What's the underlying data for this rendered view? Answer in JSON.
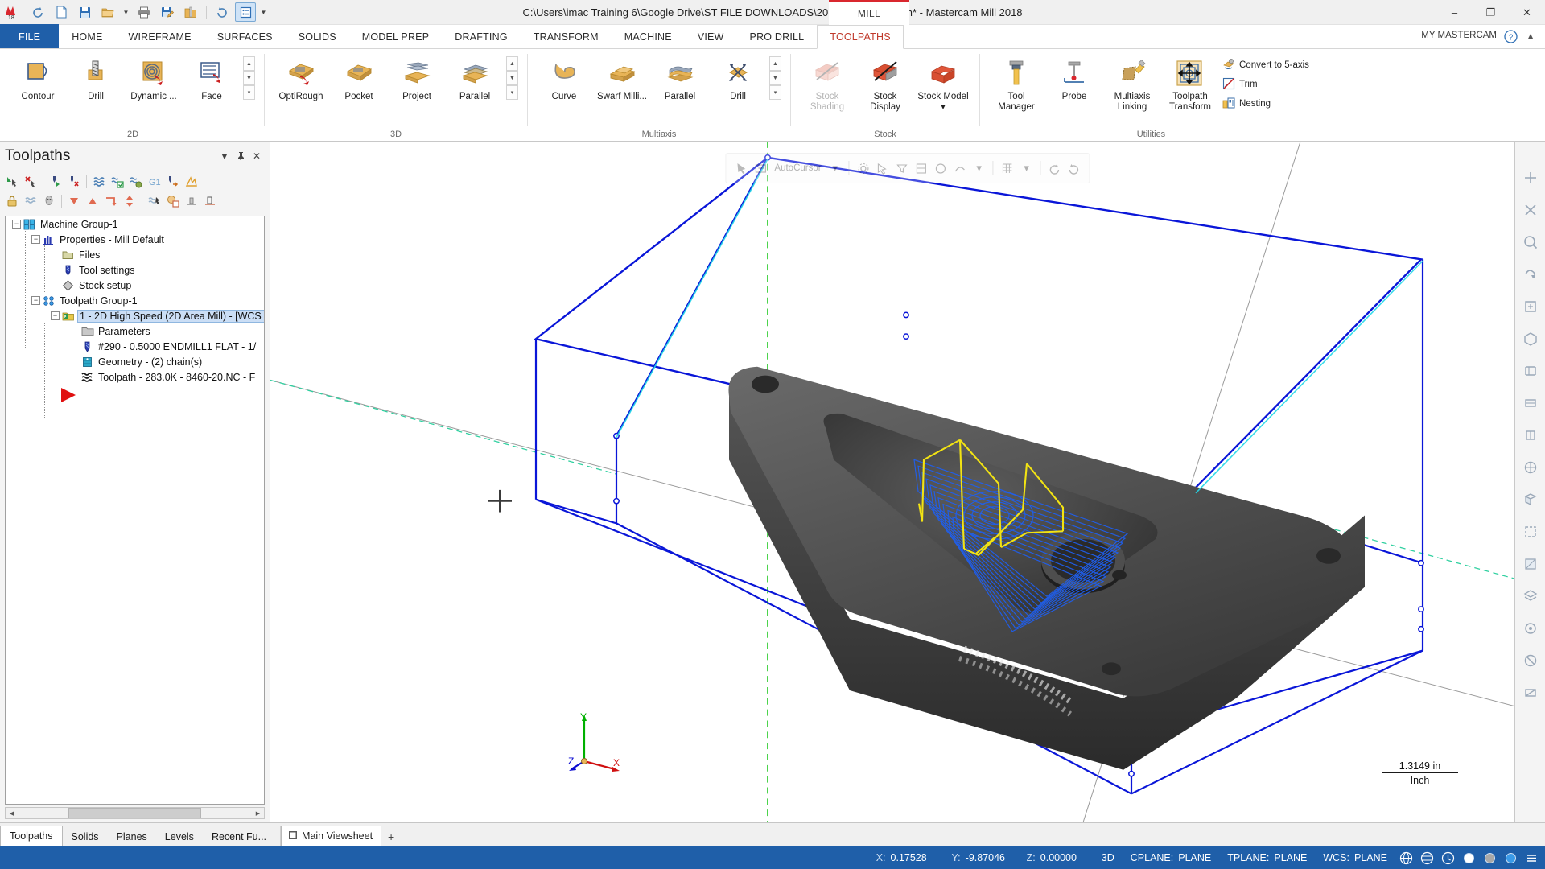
{
  "titlebar": {
    "document_path": "C:\\Users\\imac Training 6\\Google Drive\\ST FILE DOWNLOADS\\2018\\8460-20.mcam* - Mastercam Mill 2018",
    "machine_tab": "MILL",
    "quick_access": [
      {
        "name": "redo-arrow-icon",
        "glyph": "↷"
      },
      {
        "name": "new-file-icon",
        "glyph": "new"
      },
      {
        "name": "save-icon",
        "glyph": "save"
      },
      {
        "name": "open-folder-icon",
        "glyph": "open"
      },
      {
        "name": "open-dropdown-caret",
        "glyph": "▾"
      },
      {
        "name": "print-icon",
        "glyph": "print"
      },
      {
        "name": "save-as-icon",
        "glyph": "saveas"
      },
      {
        "name": "zip2go-icon",
        "glyph": "zip"
      },
      {
        "name": "undo-icon",
        "glyph": "↶"
      },
      {
        "name": "toolpath-manager-icon",
        "glyph": "tpm"
      },
      {
        "name": "customize-qat-caret",
        "glyph": "▾"
      }
    ],
    "window_controls": {
      "minimize": "–",
      "maximize": "❐",
      "close": "✕"
    }
  },
  "ribbon_tabs": {
    "file": "FILE",
    "items": [
      "HOME",
      "WIREFRAME",
      "SURFACES",
      "SOLIDS",
      "MODEL PREP",
      "DRAFTING",
      "TRANSFORM",
      "MACHINE",
      "VIEW",
      "PRO DRILL",
      "TOOLPATHS"
    ],
    "selected": "TOOLPATHS",
    "my_mastercam": "MY MASTERCAM",
    "help_icon": "help-icon",
    "collapse_icon": "chevron-up-icon"
  },
  "ribbon": {
    "groups": [
      {
        "label": "2D",
        "buttons": [
          {
            "label": "Contour",
            "icon": "contour-icon",
            "disabled": false
          },
          {
            "label": "Drill",
            "icon": "drill-icon",
            "disabled": false
          },
          {
            "label": "Dynamic ...",
            "icon": "dynamic-mill-icon",
            "disabled": false
          },
          {
            "label": "Face",
            "icon": "face-icon",
            "disabled": false
          }
        ],
        "has_scroller": true
      },
      {
        "label": "3D",
        "buttons": [
          {
            "label": "OptiRough",
            "icon": "optirough-icon",
            "disabled": false
          },
          {
            "label": "Pocket",
            "icon": "pocket-3d-icon",
            "disabled": false
          },
          {
            "label": "Project",
            "icon": "project-icon",
            "disabled": false
          },
          {
            "label": "Parallel",
            "icon": "parallel-3d-icon",
            "disabled": false
          }
        ],
        "has_scroller": true
      },
      {
        "label": "Multiaxis",
        "buttons": [
          {
            "label": "Curve",
            "icon": "curve-icon",
            "disabled": false
          },
          {
            "label": "Swarf Milli...",
            "icon": "swarf-milling-icon",
            "disabled": false
          },
          {
            "label": "Parallel",
            "icon": "parallel-multiaxis-icon",
            "disabled": false
          },
          {
            "label": "Drill",
            "icon": "drill-multiaxis-icon",
            "disabled": false
          }
        ],
        "has_scroller": true
      },
      {
        "label": "Stock",
        "buttons": [
          {
            "label": "Stock Shading",
            "icon": "stock-shading-icon",
            "disabled": true
          },
          {
            "label": "Stock Display",
            "icon": "stock-display-icon",
            "disabled": false
          },
          {
            "label": "Stock Model ▾",
            "icon": "stock-model-icon",
            "disabled": false
          }
        ],
        "has_scroller": false
      },
      {
        "label": "Utilities",
        "buttons": [
          {
            "label": "Tool Manager",
            "icon": "tool-manager-icon",
            "disabled": false
          },
          {
            "label": "Probe",
            "icon": "probe-icon",
            "disabled": false
          },
          {
            "label": "Multiaxis Linking",
            "icon": "multiaxis-linking-icon",
            "disabled": false
          },
          {
            "label": "Toolpath Transform",
            "icon": "toolpath-transform-icon",
            "disabled": false
          }
        ],
        "small_buttons": [
          {
            "label": "Convert to 5-axis",
            "icon": "convert-5axis-icon"
          },
          {
            "label": "Trim",
            "icon": "trim-icon"
          },
          {
            "label": "Nesting",
            "icon": "nesting-icon"
          }
        ],
        "has_scroller": false
      }
    ]
  },
  "toolpaths_panel": {
    "title": "Toolpaths",
    "header_buttons": [
      {
        "name": "panel-dropdown-icon",
        "glyph": "▾"
      },
      {
        "name": "panel-pin-icon",
        "glyph": "pin"
      },
      {
        "name": "panel-close-icon",
        "glyph": "✕"
      }
    ],
    "toolbar_row1": [
      "select-all-icon",
      "deselect-all-icon",
      "select-invalid-icon",
      "delete-selected-icon",
      "regen-dirty-icon",
      "regen-selected-icon",
      "regen-all-icon",
      "g1-post-icon",
      "post-selected-icon",
      "high-feed-icon"
    ],
    "toolbar_row2": [
      "lock-icon",
      "toggle-display-icon",
      "toggle-posting-icon",
      "move-down-icon",
      "move-up-icon",
      "move-into-icon",
      "move-updown-icon",
      "verify-icon",
      "simulate-icon",
      "backplot-icon",
      "config-icon"
    ],
    "tree": [
      {
        "depth": 0,
        "label": "Machine Group-1",
        "icon": "machine-group-icon",
        "expander": "-",
        "selected": false
      },
      {
        "depth": 1,
        "label": "Properties - Mill Default",
        "icon": "properties-icon",
        "expander": "-",
        "selected": false
      },
      {
        "depth": 2,
        "label": "Files",
        "icon": "files-folder-icon",
        "expander": "",
        "selected": false
      },
      {
        "depth": 2,
        "label": "Tool settings",
        "icon": "tool-settings-icon",
        "expander": "",
        "selected": false
      },
      {
        "depth": 2,
        "label": "Stock setup",
        "icon": "stock-setup-icon",
        "expander": "",
        "selected": false
      },
      {
        "depth": 1,
        "label": "Toolpath Group-1",
        "icon": "toolpath-group-icon",
        "expander": "-",
        "selected": false
      },
      {
        "depth": 2,
        "label": "1 - 2D High Speed (2D Area Mill) - [WCS",
        "icon": "toolpath-folder-icon",
        "expander": "-",
        "selected": true
      },
      {
        "depth": 3,
        "label": "Parameters",
        "icon": "parameters-icon",
        "expander": "",
        "selected": false
      },
      {
        "depth": 3,
        "label": "#290 - 0.5000 ENDMILL1 FLAT - 1/",
        "icon": "endmill-tool-icon",
        "expander": "",
        "selected": false
      },
      {
        "depth": 3,
        "label": "Geometry -  (2) chain(s)",
        "icon": "geometry-icon",
        "expander": "",
        "selected": false
      },
      {
        "depth": 3,
        "label": "Toolpath - 283.0K - 8460-20.NC - F",
        "icon": "toolpath-nc-icon",
        "expander": "",
        "selected": false
      },
      {
        "depth": 2,
        "label": "",
        "icon": "insert-arrow-icon",
        "expander": "",
        "selected": false
      }
    ],
    "scroll": {
      "left_arrow": "◀",
      "right_arrow": "▶"
    }
  },
  "viewport": {
    "floating_toolbar": [
      {
        "name": "select-entity-icon",
        "glyph": "pointer"
      },
      {
        "name": "autocursor-icon",
        "glyph": "autocursor"
      },
      {
        "name": "autocursor-label",
        "glyph": "AutoCursor"
      },
      {
        "name": "autocursor-dropdown-icon",
        "glyph": "▾"
      },
      {
        "name": "select-settings-icon",
        "glyph": "gear"
      },
      {
        "name": "select-all-entities-icon",
        "glyph": "all"
      },
      {
        "name": "selection-filter-1-icon",
        "glyph": "f1"
      },
      {
        "name": "selection-filter-2-icon",
        "glyph": "f2"
      },
      {
        "name": "selection-filter-3-icon",
        "glyph": "f3"
      },
      {
        "name": "selection-filter-4-icon",
        "glyph": "f4"
      },
      {
        "name": "filter-dropdown-icon",
        "glyph": "▾"
      },
      {
        "name": "grid-snap-icon",
        "glyph": "grid"
      },
      {
        "name": "grid-dropdown-icon",
        "glyph": "▾"
      },
      {
        "name": "undo-view-icon",
        "glyph": "undoview"
      },
      {
        "name": "redo-view-icon",
        "glyph": "redoview"
      }
    ],
    "axis_labels": {
      "x": "X",
      "y": "Y",
      "z": "Z"
    },
    "scale_value": "1.3149 in",
    "scale_unit": "Inch",
    "side_toolbar": [
      "fit-to-screen-icon",
      "unzoom-icon",
      "zoom-window-icon",
      "dynamic-rotate-icon",
      "pan-icon",
      "isometric-view-icon",
      "front-view-icon",
      "top-view-icon",
      "right-view-icon",
      "wireframe-shading-icon",
      "shaded-view-icon",
      "hidden-lines-icon",
      "translucency-icon",
      "levels-icon",
      "blank-icon",
      "clear-colors-icon",
      "hide-entities-icon"
    ]
  },
  "bottom_tabs": {
    "items": [
      "Toolpaths",
      "Solids",
      "Planes",
      "Levels",
      "Recent Fu..."
    ],
    "selected": "Toolpaths",
    "viewsheet": {
      "label": "Main Viewsheet",
      "icon": "viewsheet-icon",
      "add": "+"
    }
  },
  "statusbar": {
    "coords": [
      {
        "key": "X:",
        "value": "0.17528"
      },
      {
        "key": "Y:",
        "value": "-9.87046"
      },
      {
        "key": "Z:",
        "value": "0.00000"
      }
    ],
    "mode": "3D",
    "planes": [
      {
        "key": "CPLANE:",
        "value": "PLANE"
      },
      {
        "key": "TPLANE:",
        "value": "PLANE"
      },
      {
        "key": "WCS:",
        "value": "PLANE"
      }
    ],
    "icons": [
      "globe-icon",
      "globe-alt-icon",
      "clock-icon",
      "white-swatch",
      "gray-swatch",
      "blue-swatch",
      "menu-icon"
    ]
  },
  "colors": {
    "accent_blue": "#1f5fa9",
    "file_tab_blue": "#1f5fa9",
    "selected_tab_red": "#c0392b",
    "mill_accent_red": "#d9272e",
    "stock_wire_blue": "#0a16d8",
    "toolpath_blue": "#2255e8",
    "toolpath_yellow": "#f2e313",
    "part_gray": "#4a4a4a",
    "axis_green": "#00b000",
    "axis_red": "#d01010",
    "axis_blue": "#0a0ad0"
  }
}
